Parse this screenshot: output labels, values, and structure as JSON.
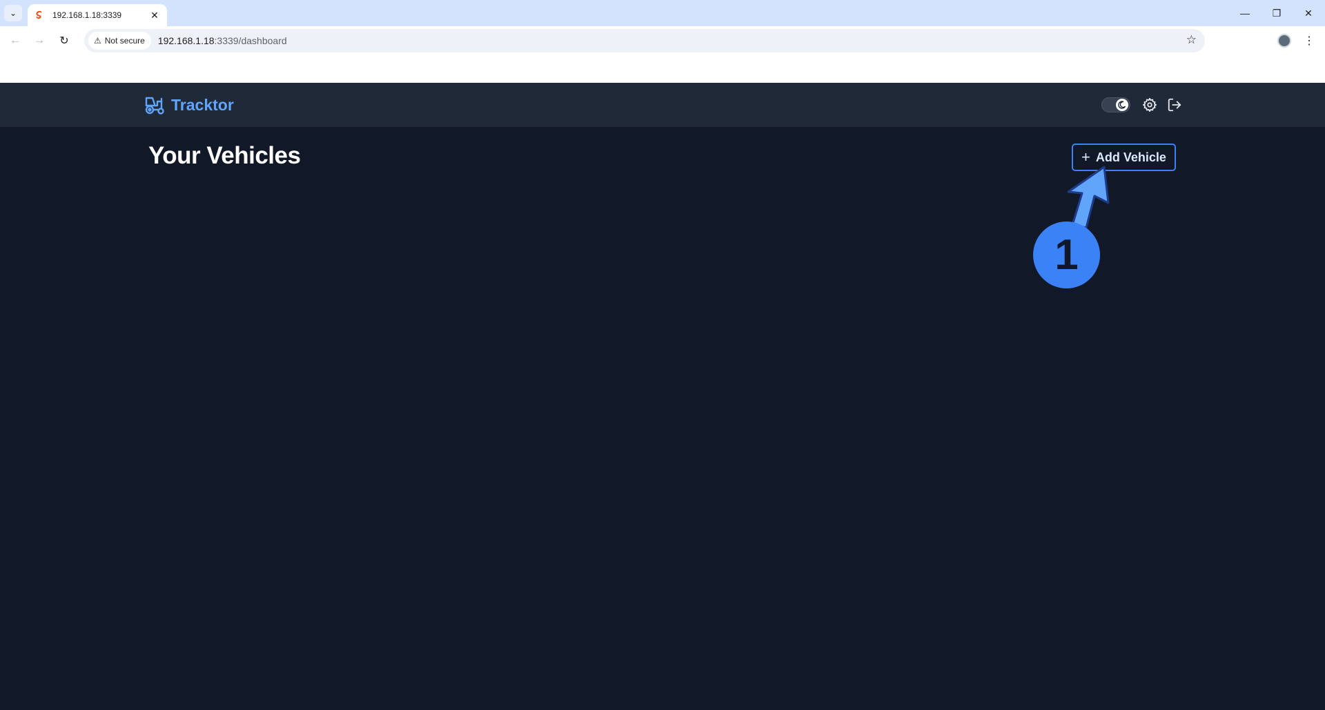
{
  "browser": {
    "tab_title": "192.168.1.18:3339",
    "security_label": "Not secure",
    "url_host": "192.168.1.18",
    "url_path": ":3339/dashboard",
    "icons": [
      "tab-list-icon",
      "favicon-icon",
      "close-icon",
      "minimize-icon",
      "restore-icon",
      "window-close-icon",
      "back-icon",
      "forward-icon",
      "reload-icon",
      "warning-icon",
      "star-icon",
      "profile-avatar",
      "kebab-menu-icon"
    ]
  },
  "header": {
    "brand": "Tracktor",
    "brand_color": "#60a5fa",
    "icons": [
      "tractor-icon",
      "moon-icon",
      "gear-icon",
      "logout-icon"
    ]
  },
  "main": {
    "title": "Your Vehicles",
    "add_button_label": "Add Vehicle",
    "add_button_icon": "plus-icon"
  },
  "annotation": {
    "step_number": "1",
    "color": "#3b82f6"
  }
}
